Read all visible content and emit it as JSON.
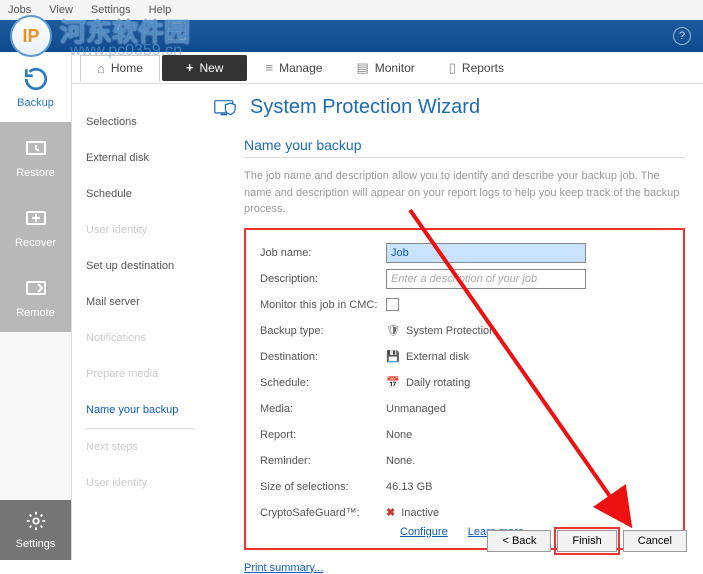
{
  "menu": {
    "items": [
      "Jobs",
      "View",
      "Settings",
      "Help"
    ]
  },
  "watermark": {
    "line1": "河东软件园",
    "line2": "www.pc0359.cn",
    "logo": "IP"
  },
  "leftbar": {
    "items": [
      {
        "key": "backup",
        "label": "Backup",
        "active": true
      },
      {
        "key": "restore",
        "label": "Restore"
      },
      {
        "key": "recover",
        "label": "Recover"
      },
      {
        "key": "remote",
        "label": "Remote"
      }
    ],
    "settings": "Settings"
  },
  "tabs": {
    "home": "Home",
    "new": "New",
    "manage": "Manage",
    "monitor": "Monitor",
    "reports": "Reports"
  },
  "wizard": {
    "title": "System Protection Wizard",
    "section": "Name your backup",
    "desc": "The job name and description allow you to identify and describe your backup job. The name and description will appear on your report logs to help you keep track of the backup process.",
    "steps": [
      {
        "label": "Selections",
        "state": ""
      },
      {
        "label": "External disk",
        "state": ""
      },
      {
        "label": "Schedule",
        "state": ""
      },
      {
        "label": "User identity",
        "state": "disabled"
      },
      {
        "label": "Set up destination",
        "state": ""
      },
      {
        "label": "Mail server",
        "state": ""
      },
      {
        "label": "Notifications",
        "state": "disabled"
      },
      {
        "label": "Prepare media",
        "state": "disabled"
      },
      {
        "label": "Name your backup",
        "state": "current"
      },
      {
        "label": "Next steps",
        "state": "disabled"
      },
      {
        "label": "User identity",
        "state": "disabled"
      }
    ],
    "fields": {
      "jobname_label": "Job name:",
      "jobname_value": "Job",
      "description_label": "Description:",
      "description_placeholder": "Enter a description of your job",
      "monitor_label": "Monitor this job in CMC:",
      "backuptype_label": "Backup type:",
      "backuptype_value": "System Protection",
      "destination_label": "Destination:",
      "destination_value": "External disk",
      "schedule_label": "Schedule:",
      "schedule_value": "Daily rotating",
      "media_label": "Media:",
      "media_value": "Unmanaged",
      "report_label": "Report:",
      "report_value": "None",
      "reminder_label": "Reminder:",
      "reminder_value": "None.",
      "size_label": "Size of selections:",
      "size_value": "46.13 GB",
      "csg_label": "CryptoSafeGuard™:",
      "csg_value": "Inactive",
      "configure": "Configure",
      "learnmore": "Learn more",
      "print": "Print summary..."
    },
    "buttons": {
      "back": "< Back",
      "finish": "Finish",
      "cancel": "Cancel"
    }
  }
}
